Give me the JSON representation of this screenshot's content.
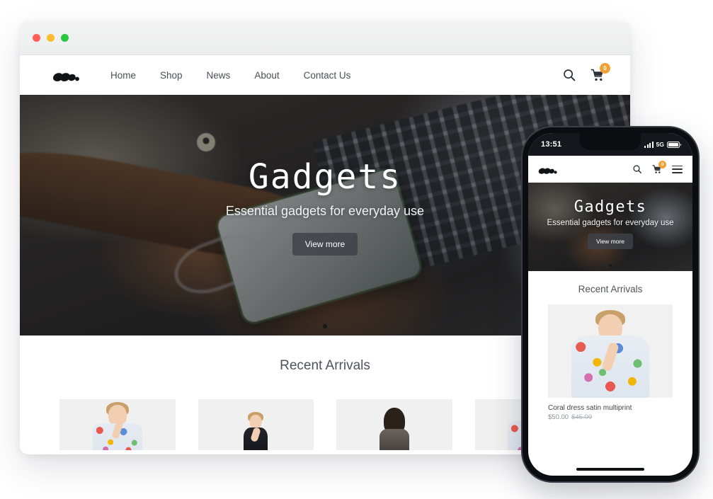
{
  "desktop": {
    "window": {
      "traffic_lights": [
        {
          "name": "close",
          "color": "#ff5f57"
        },
        {
          "name": "minimize",
          "color": "#febc2e"
        },
        {
          "name": "maximize",
          "color": "#28c840"
        }
      ]
    },
    "nav": {
      "logo": "m-logo",
      "links": [
        "Home",
        "Shop",
        "News",
        "About",
        "Contact Us"
      ],
      "search_icon": "search-icon",
      "cart_icon": "cart-icon",
      "cart_count": "0",
      "cart_badge_color": "#f0a135"
    },
    "hero": {
      "title": "Gadgets",
      "subtitle": "Essential gadgets for everyday use",
      "cta": "View more",
      "dots": 1
    },
    "arrivals": {
      "title": "Recent Arrivals",
      "products": [
        {
          "alt": "floral-dress-model"
        },
        {
          "alt": "black-dress-model"
        },
        {
          "alt": "dark-hair-coat-model"
        },
        {
          "alt": "floral-print-model"
        }
      ]
    }
  },
  "phone": {
    "status": {
      "time": "13:51",
      "network": "5G",
      "signal_icon": "signal-bars-icon",
      "battery_icon": "battery-icon"
    },
    "nav": {
      "logo": "m-logo",
      "search_icon": "search-icon",
      "cart_icon": "cart-icon",
      "cart_count": "0",
      "menu_icon": "hamburger-menu-icon"
    },
    "hero": {
      "title": "Gadgets",
      "subtitle": "Essential gadgets for everyday use",
      "cta": "View more"
    },
    "arrivals": {
      "title": "Recent Arrivals",
      "product": {
        "name": "Coral dress satin multiprint",
        "price": "$50.00",
        "old_price": "$45.00"
      }
    }
  }
}
